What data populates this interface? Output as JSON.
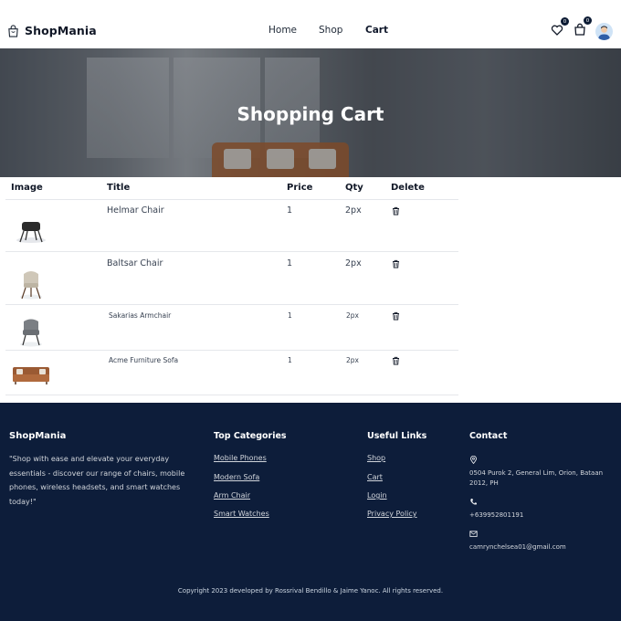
{
  "brand": {
    "name": "ShopMania",
    "icon": "shopping-bag-icon"
  },
  "nav": {
    "home": "Home",
    "shop": "Shop",
    "cart": "Cart"
  },
  "header_icons": {
    "wishlist_count": "0",
    "cart_count": "0"
  },
  "hero": {
    "title": "Shopping Cart"
  },
  "table": {
    "headers": {
      "image": "Image",
      "title": "Title",
      "price": "Price",
      "qty": "Qty",
      "delete": "Delete"
    },
    "rows": [
      {
        "title": "Helmar Chair",
        "price": "1",
        "qty": "2px",
        "image": "black-chair-image"
      },
      {
        "title": "Baltsar Chair",
        "price": "1",
        "qty": "2px",
        "image": "beige-chair-image"
      },
      {
        "title": "Sakarias Armchair",
        "price": "1",
        "qty": "2px",
        "image": "grey-armchair-image"
      },
      {
        "title": "Acme Furniture Sofa",
        "price": "1",
        "qty": "2px",
        "image": "brown-sofa-image"
      }
    ]
  },
  "footer": {
    "brand": "ShopMania",
    "tagline": "\"Shop with ease and elevate your everyday essentials - discover our range of chairs, mobile phones, wireless headsets, and smart watches today!\"",
    "categories_title": "Top Categories",
    "categories": [
      "Mobile Phones",
      "Modern Sofa",
      "Arm Chair",
      "Smart Watches"
    ],
    "links_title": "Useful Links",
    "links": [
      "Shop",
      "Cart",
      "Login",
      "Privacy Policy"
    ],
    "contact_title": "Contact",
    "address": "0504 Purok 2, General Lim, Orion, Bataan 2012, PH",
    "phone": "+639952801191",
    "email": "camrynchelsea01@gmail.com",
    "copyright": "Copyright 2023 developed by Rossrival Bendillo & Jaime Yanoc. All rights reserved."
  },
  "colors": {
    "footer_bg": "#0d1d3a",
    "text_dark": "#111827"
  }
}
